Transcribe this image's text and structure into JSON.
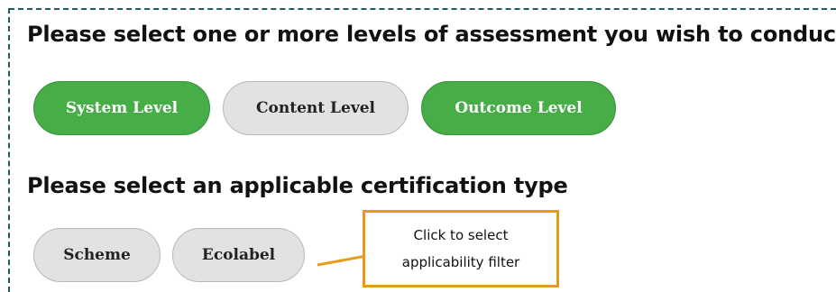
{
  "sections": {
    "assessment": {
      "title": "Please select one or more levels of assessment you wish to conduct",
      "buttons": {
        "system": "System Level",
        "content": "Content Level",
        "outcome": "Outcome Level"
      }
    },
    "certification": {
      "title": "Please select an applicable certification type",
      "buttons": {
        "scheme": "Scheme",
        "ecolabel": "Ecolabel"
      }
    }
  },
  "callout": {
    "line1": "Click to select",
    "line2": "applicability filter"
  },
  "colors": {
    "selected": "#47ad47",
    "unselected": "#e2e2e2",
    "callout_border": "#e69b1e",
    "frame_dash": "#1f5c5c"
  }
}
